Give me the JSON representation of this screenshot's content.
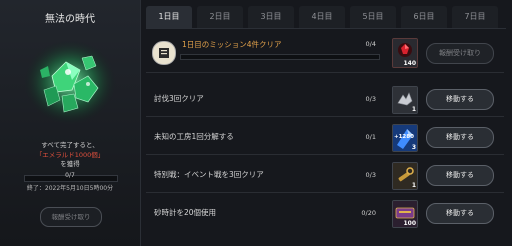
{
  "left_panel": {
    "title": "無法の時代",
    "description_line1": "すべて完了すると、",
    "reward_name": "「エメラルド1000個」",
    "description_line3": "を獲得",
    "progress_text": "0/7",
    "end_time": "終了：2022年5月10日5時00分",
    "claim_button": "報酬受け取り"
  },
  "tabs": [
    "1日目",
    "2日目",
    "3日目",
    "4日目",
    "5日目",
    "6日目",
    "7日目"
  ],
  "active_tab_index": 0,
  "main_mission": {
    "label": "1日目のミッション4件クリア",
    "count": "0/4",
    "reward_qty": "140",
    "button": "報酬受け取り"
  },
  "missions": [
    {
      "label": "討伐3回クリア",
      "count": "0/3",
      "reward_qty": "1",
      "button": "移動する"
    },
    {
      "label": "未知の工房1回分解する",
      "count": "0/1",
      "reward_qty": "3",
      "reward_caption": "+1280",
      "button": "移動する"
    },
    {
      "label": "特別戦：イベント戦を3回クリア",
      "count": "0/3",
      "reward_qty": "1",
      "button": "移動する"
    },
    {
      "label": "砂時計を20個使用",
      "count": "0/20",
      "reward_qty": "100",
      "button": "移動する"
    }
  ],
  "colors": {
    "accent_orange": "#e3a24b",
    "highlight_red": "#e2503d"
  }
}
